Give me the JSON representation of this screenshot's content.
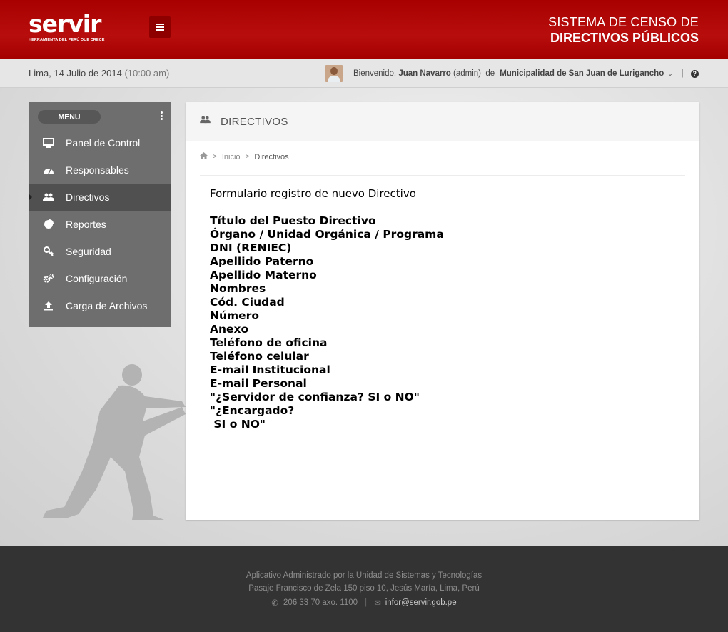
{
  "header": {
    "logo_text": "servir",
    "logo_tagline": "HERRAMIENTA DEL PERÚ QUE CRECE",
    "system_title_line1": "SISTEMA DE CENSO  DE",
    "system_title_line2": "DIRECTIVOS PÚBLICOS"
  },
  "infobar": {
    "date": "Lima, 14 Julio de 2014",
    "time": "(10:00 am)",
    "welcome": "Bienvenido,",
    "user_name": "Juan Navarro",
    "role": "(admin)",
    "of": "de",
    "organization": "Municipalidad de San Juan de Lurigancho"
  },
  "sidebar": {
    "menu_label": "MENU",
    "items": [
      {
        "label": "Panel de Control",
        "icon": "monitor-icon"
      },
      {
        "label": "Responsables",
        "icon": "dashboard-icon"
      },
      {
        "label": "Directivos",
        "icon": "users-icon",
        "active": true
      },
      {
        "label": "Reportes",
        "icon": "pie-chart-icon"
      },
      {
        "label": "Seguridad",
        "icon": "key-icon"
      },
      {
        "label": "Configuración",
        "icon": "gears-icon"
      },
      {
        "label": "Carga de Archivos",
        "icon": "upload-icon"
      }
    ]
  },
  "main": {
    "title": "DIRECTIVOS",
    "breadcrumb": {
      "home_icon": "home-icon",
      "items": [
        "Inicio",
        "Directivos"
      ]
    },
    "form_title": "Formulario registro de nuevo Directivo",
    "fields": [
      "Título del Puesto Directivo",
      "Órgano / Unidad Orgánica / Programa",
      "DNI (RENIEC)",
      "Apellido Paterno",
      "Apellido Materno",
      "Nombres",
      "Cód. Ciudad",
      "Número",
      "Anexo",
      "Teléfono de oficina",
      "Teléfono celular",
      "E-mail Institucional",
      "E-mail Personal",
      "\"¿Servidor de confianza? SI o NO\"",
      "\"¿Encargado?",
      " SI o NO\""
    ]
  },
  "footer": {
    "line1": "Aplicativo Administrado por la Unidad de Sistemas y Tecnologías",
    "line2": "Pasaje Francisco de Zela 150 piso 10, Jesús María, Lima, Perú",
    "phone": "206 33 70 axo. 1100",
    "email": "infor@servir.gob.pe"
  },
  "colors": {
    "brand_red": "#a80000",
    "sidebar": "#6e6e6e",
    "sidebar_active": "#505050",
    "footer": "#333333"
  }
}
